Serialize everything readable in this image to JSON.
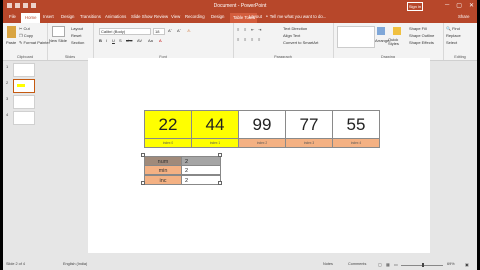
{
  "app": {
    "title": "Document - PowerPoint",
    "sign_in": "Sign in",
    "window_controls": [
      "─",
      "▢",
      "✕"
    ]
  },
  "ribbon_tabs": {
    "items": [
      "File",
      "Home",
      "Insert",
      "Design",
      "Transitions",
      "Animations",
      "Slide Show",
      "Review",
      "View",
      "Recording",
      "Design",
      "Layout"
    ],
    "active_index": 1,
    "context_label": "Table Tools",
    "tell_me": "Tell me what you want to do...",
    "share": "Share"
  },
  "ribbon": {
    "clipboard": {
      "paste": "Paste",
      "cut": "Cut",
      "copy": "Copy",
      "format_painter": "Format Painter",
      "group": "Clipboard"
    },
    "slides": {
      "new_slide": "New Slide",
      "layout": "Layout",
      "reset": "Reset",
      "section": "Section",
      "group": "Slides"
    },
    "font": {
      "name": "Calibri (Body)",
      "size": "18",
      "group": "Font"
    },
    "paragraph": {
      "text_direction": "Text Direction",
      "align_text": "Align Text",
      "convert_smartart": "Convert to SmartArt",
      "group": "Paragraph"
    },
    "drawing": {
      "arrange": "Arrange",
      "quick_styles": "Quick Styles",
      "shape_fill": "Shape Fill",
      "shape_outline": "Shape Outline",
      "shape_effects": "Shape Effects",
      "group": "Drawing"
    },
    "editing": {
      "find": "Find",
      "replace": "Replace",
      "select": "Select",
      "group": "Editing"
    }
  },
  "thumbnails": {
    "numbers": [
      "1",
      "2",
      "3",
      "4"
    ],
    "selected_index": 1
  },
  "slide": {
    "array_cells": [
      {
        "value": "22",
        "label": "index 0",
        "top_color": "#ffff00",
        "bottom_color": "#ffff00"
      },
      {
        "value": "44",
        "label": "index 1",
        "top_color": "#ffff00",
        "bottom_color": "#ffff00"
      },
      {
        "value": "99",
        "label": "index 2",
        "top_color": "#ffffff",
        "bottom_color": "#f4b183"
      },
      {
        "value": "77",
        "label": "index 3",
        "top_color": "#ffffff",
        "bottom_color": "#f4b183"
      },
      {
        "value": "55",
        "label": "index 4",
        "top_color": "#ffffff",
        "bottom_color": "#f4b183"
      }
    ],
    "vars_table": [
      {
        "name": "num",
        "value": "2",
        "name_color": "#a08a7a",
        "value_color": "#a5a5a5"
      },
      {
        "name": "min",
        "value": "2",
        "name_color": "#f4b183",
        "value_color": "#ffffff"
      },
      {
        "name": "inc",
        "value": "2",
        "name_color": "#f4b183",
        "value_color": "#ffffff"
      }
    ]
  },
  "status": {
    "slide_of": "Slide 2 of 4",
    "language": "English (India)",
    "notes": "Notes",
    "comments": "Comments",
    "zoom": "69%"
  },
  "colors": {
    "accent": "#b7472a"
  }
}
